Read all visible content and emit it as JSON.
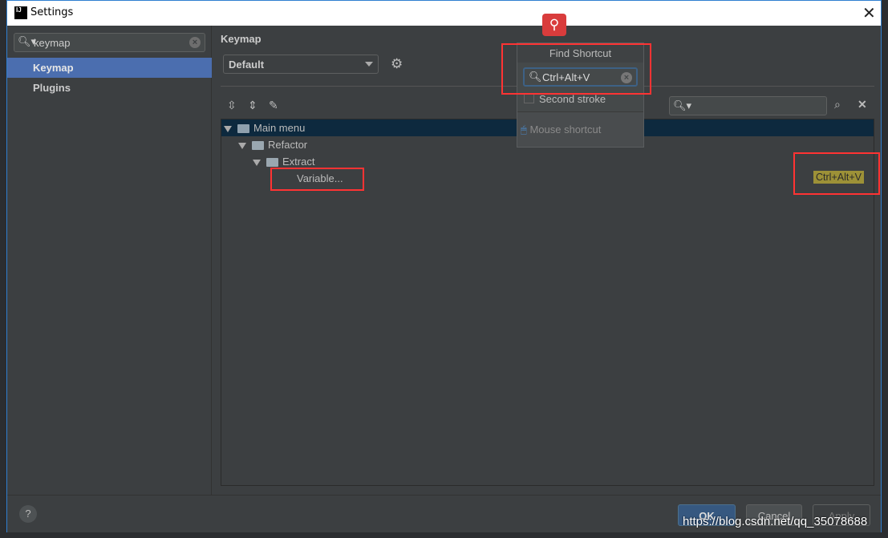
{
  "window": {
    "title": "Settings",
    "logo": "IJ",
    "close": "✕"
  },
  "sidebar": {
    "search_value": "keymap",
    "items": [
      {
        "label": "Keymap",
        "selected": true
      },
      {
        "label": "Plugins"
      }
    ]
  },
  "main": {
    "heading": "Keymap",
    "keymap_select": "Default",
    "filter_value": "",
    "tree": [
      {
        "label": "Main menu",
        "level": 0,
        "selected": true
      },
      {
        "label": "Refactor",
        "level": 1
      },
      {
        "label": "Extract",
        "level": 2
      },
      {
        "label": "Variable...",
        "level": 3,
        "shortcut": "Ctrl+Alt+V"
      }
    ]
  },
  "find_popup": {
    "title": "Find Shortcut",
    "value": "Ctrl+Alt+V",
    "second_stroke": "Second stroke",
    "second_stroke_checked": false,
    "mouse_shortcut": "Mouse shortcut"
  },
  "footer": {
    "help": "?",
    "ok": "OK",
    "cancel": "Cancel",
    "apply": "Apply"
  },
  "watermark": "https://blog.csdn.net/qq_35078688",
  "colors": {
    "selection": "#4b6eaf",
    "shortcut_highlight": "#9d9137",
    "annotation": "#ff3333"
  }
}
